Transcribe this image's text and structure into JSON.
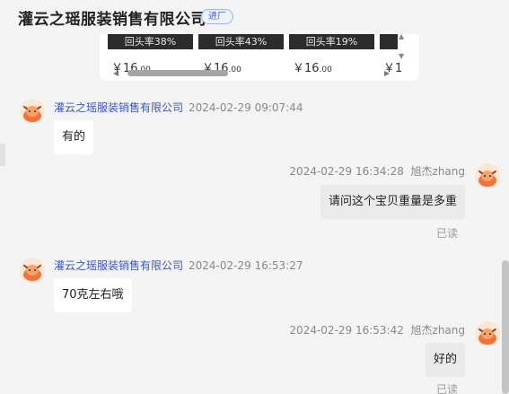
{
  "header": {
    "shop_name": "灌云之瑶服装销售有限公司",
    "tag": "进厂"
  },
  "products": [
    {
      "rate": "回头率38%",
      "price_main": "￥16",
      "price_dec": ".00"
    },
    {
      "rate": "回头率43%",
      "price_main": "￥16",
      "price_dec": ".00"
    },
    {
      "rate": "回头率19%",
      "price_main": "￥16",
      "price_dec": ".00"
    },
    {
      "rate": "",
      "price_main": "￥1",
      "price_dec": ""
    }
  ],
  "messages": [
    {
      "side": "left",
      "sender": "灌云之瑶服装销售有限公司",
      "time": "2024-02-29 09:07:44",
      "text": "有的"
    },
    {
      "side": "right",
      "sender": "旭杰zhang",
      "time": "2024-02-29 16:34:28",
      "text": "请问这个宝贝重量是多重",
      "status": "已读"
    },
    {
      "side": "left",
      "sender": "灌云之瑶服装销售有限公司",
      "time": "2024-02-29 16:53:27",
      "text": "70克左右哦"
    },
    {
      "side": "right",
      "sender": "旭杰zhang",
      "time": "2024-02-29 16:53:42",
      "text": "好的",
      "status": "已读"
    }
  ],
  "icons": {
    "avatar": "cow-mascot-icon",
    "scroll_left": "arrow-left-icon",
    "scroll_right": "arrow-right-icon"
  },
  "colors": {
    "shop_name": "#3a55b8",
    "tag": "#3d63e0",
    "self_bubble": "#eaeaea"
  }
}
